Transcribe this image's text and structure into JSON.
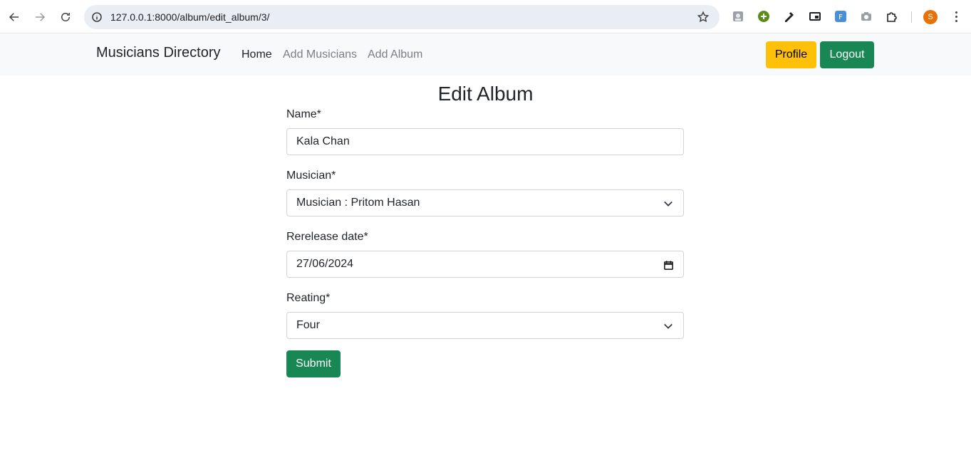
{
  "browser": {
    "url": "127.0.0.1:8000/album/edit_album/3/",
    "profile_initial": "S"
  },
  "navbar": {
    "brand": "Musicians Directory",
    "links": [
      {
        "label": "Home",
        "active": true
      },
      {
        "label": "Add Musicians",
        "active": false
      },
      {
        "label": "Add Album",
        "active": false
      }
    ],
    "profile_label": "Profile",
    "logout_label": "Logout"
  },
  "form": {
    "title": "Edit Album",
    "name_label": "Name*",
    "name_value": "Kala Chan",
    "musician_label": "Musician*",
    "musician_value": "Musician : Pritom Hasan",
    "release_label": "Rerelease date*",
    "release_value": "27/06/2024",
    "rating_label": "Reating*",
    "rating_value": "Four",
    "submit_label": "Submit"
  },
  "colors": {
    "warning": "#ffc107",
    "success": "#198754",
    "navbar_bg": "#f8f9fa"
  }
}
